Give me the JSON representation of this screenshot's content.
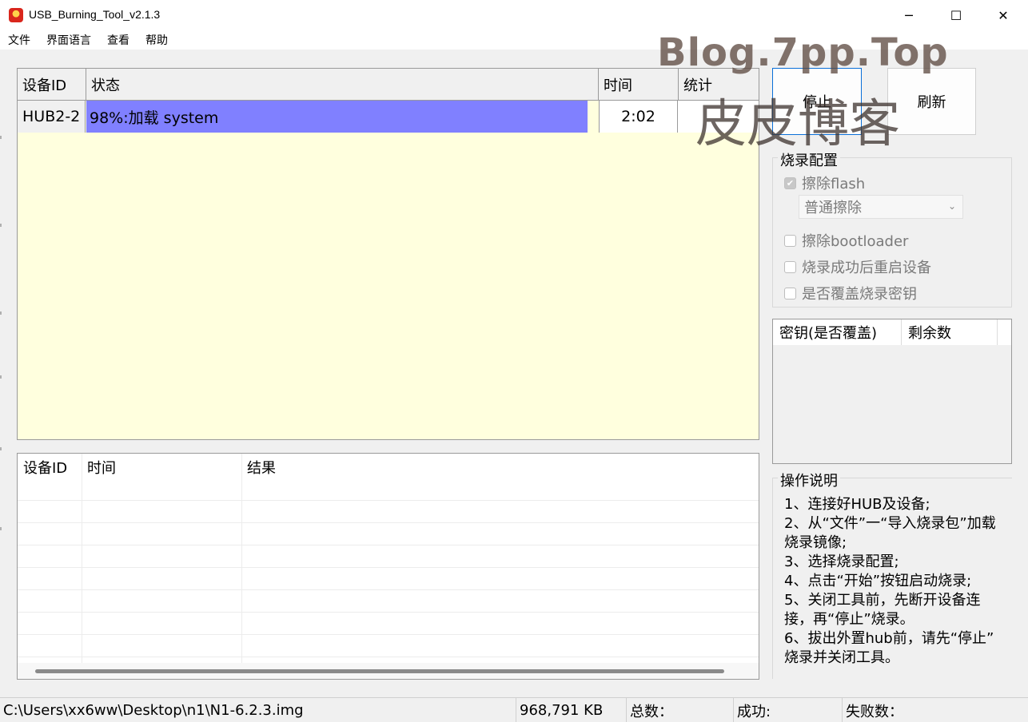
{
  "window": {
    "title": "USB_Burning_Tool_v2.1.3",
    "minimize_glyph": "─",
    "maximize_glyph": "☐",
    "close_glyph": "✕"
  },
  "menu": [
    "文件",
    "界面语言",
    "查看",
    "帮助"
  ],
  "watermark": {
    "text_en": "Blog.7pp.Top",
    "text_cn": "皮皮博客"
  },
  "device_table": {
    "headers": [
      "设备ID",
      "状态",
      "时间",
      "统计"
    ],
    "rows": [
      {
        "id": "HUB2-2",
        "status": "98%:加载 system",
        "progress_percent": 98,
        "time": "2:02",
        "stat": ""
      }
    ],
    "background_color": "#ffffde",
    "progress_color": "#8080ff"
  },
  "buttons": {
    "stop": "停止",
    "refresh": "刷新"
  },
  "config": {
    "title": "烧录配置",
    "erase_flash": {
      "label": "擦除flash",
      "checked": true,
      "disabled": true
    },
    "erase_mode": {
      "selected": "普通擦除"
    },
    "erase_bootloader": {
      "label": "擦除bootloader",
      "checked": false
    },
    "reboot_after": {
      "label": "烧录成功后重启设备",
      "checked": false
    },
    "overwrite_key": {
      "label": "是否覆盖烧录密钥",
      "checked": false
    }
  },
  "key_table": {
    "headers": [
      "密钥(是否覆盖)",
      "剩余数"
    ]
  },
  "log_table": {
    "headers": [
      "设备ID",
      "时间",
      "结果"
    ]
  },
  "help": {
    "title": "操作说明",
    "lines": [
      "1、连接好HUB及设备;",
      "2、从“文件”一“导入烧录包”加载",
      "烧录镜像;",
      "3、选择烧录配置;",
      "4、点击“开始”按钮启动烧录;",
      "5、关闭工具前，先断开设备连",
      "接，再“停止”烧录。",
      "6、拔出外置hub前，请先“停止”",
      "烧录并关闭工具。"
    ]
  },
  "statusbar": {
    "file_path": "C:\\Users\\xx6ww\\Desktop\\n1\\N1-6.2.3.img",
    "file_size": "968,791 KB",
    "total_label": "总数：",
    "success_label": "成功:",
    "fail_label": "失败数："
  }
}
